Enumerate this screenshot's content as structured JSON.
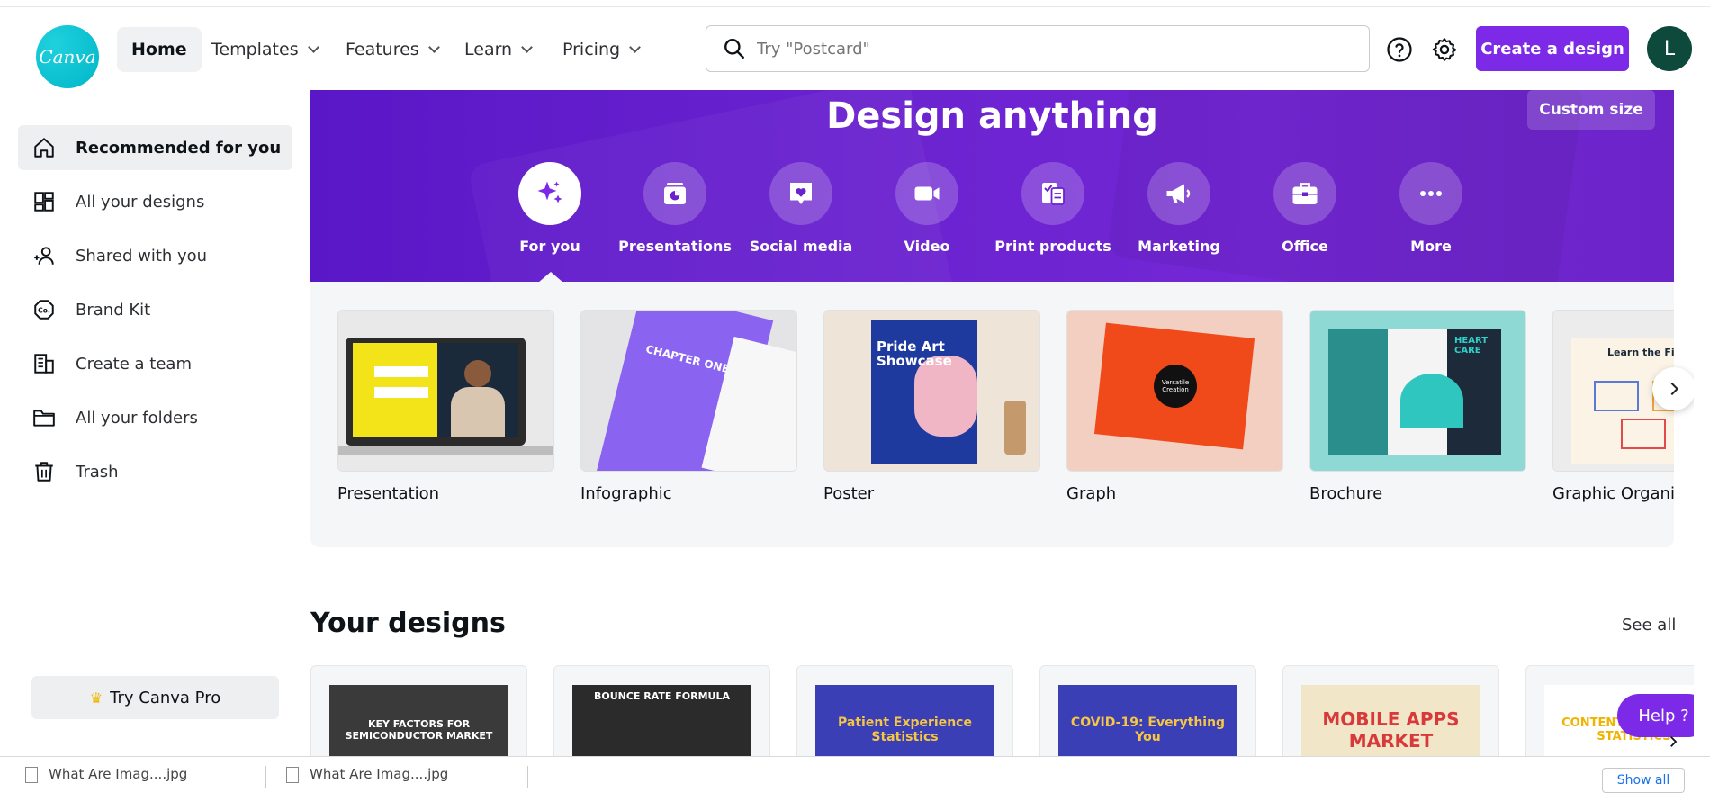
{
  "header": {
    "logo_text": "Canva",
    "nav": [
      {
        "label": "Home",
        "active": true
      },
      {
        "label": "Templates"
      },
      {
        "label": "Features"
      },
      {
        "label": "Learn"
      },
      {
        "label": "Pricing"
      }
    ],
    "search_placeholder": "Try \"Postcard\"",
    "create_label": "Create a design",
    "avatar_initial": "L",
    "brand_color": "#7d2ae8"
  },
  "sidebar": {
    "items": [
      {
        "label": "Recommended for you",
        "icon": "home-icon",
        "active": true
      },
      {
        "label": "All your designs",
        "icon": "grid-icon"
      },
      {
        "label": "Shared with you",
        "icon": "users-icon"
      },
      {
        "label": "Brand Kit",
        "icon": "brand-kit-icon"
      },
      {
        "label": "Create a team",
        "icon": "team-building-icon"
      },
      {
        "label": "All your folders",
        "icon": "folder-icon"
      },
      {
        "label": "Trash",
        "icon": "trash-icon"
      }
    ],
    "pro_label": "Try Canva Pro"
  },
  "hero": {
    "title": "Design anything",
    "custom_size": "Custom size",
    "categories": [
      {
        "label": "For you",
        "icon": "sparkle-icon",
        "active": true
      },
      {
        "label": "Presentations",
        "icon": "presentation-icon"
      },
      {
        "label": "Social media",
        "icon": "heart-chat-icon"
      },
      {
        "label": "Video",
        "icon": "video-camera-icon"
      },
      {
        "label": "Print products",
        "icon": "print-icon"
      },
      {
        "label": "Marketing",
        "icon": "megaphone-icon"
      },
      {
        "label": "Office",
        "icon": "briefcase-icon"
      },
      {
        "label": "More",
        "icon": "more-dots-icon"
      }
    ]
  },
  "templates": [
    {
      "label": "Presentation"
    },
    {
      "label": "Infographic",
      "thumb_text": "CHAPTER ONE"
    },
    {
      "label": "Poster",
      "thumb_text": "Pride Art Showcase"
    },
    {
      "label": "Graph",
      "thumb_text": "Versatile Creation"
    },
    {
      "label": "Brochure",
      "thumb_text": "HEART CARE"
    },
    {
      "label": "Graphic Organizer",
      "thumb_text": "Learn the Five S"
    }
  ],
  "your_designs": {
    "title": "Your designs",
    "see_all": "See all",
    "items": [
      {
        "text": "KEY FACTORS FOR SEMICONDUCTOR MARKET",
        "bg": "#3a3a3a",
        "fg": "#ffffff"
      },
      {
        "text": "BOUNCE RATE FORMULA",
        "bg": "#2b2b2b",
        "fg": "#ffffff"
      },
      {
        "text": "Patient Experience Statistics",
        "bg": "#3b3fb6",
        "fg": "#f6c644"
      },
      {
        "text": "COVID-19: Everything You",
        "bg": "#3b3fb6",
        "fg": "#f6c644"
      },
      {
        "text": "MOBILE APPS MARKET",
        "bg": "#f2e6c8",
        "fg": "#d8393a"
      },
      {
        "text": "CONTENT MARKETING STATISTICS",
        "bg": "#ffffff",
        "fg": "#f0b400"
      }
    ]
  },
  "help_label": "Help ?",
  "downloads": {
    "items": [
      "What Are Imag....jpg",
      "What Are Imag....jpg"
    ],
    "show_all": "Show all"
  }
}
